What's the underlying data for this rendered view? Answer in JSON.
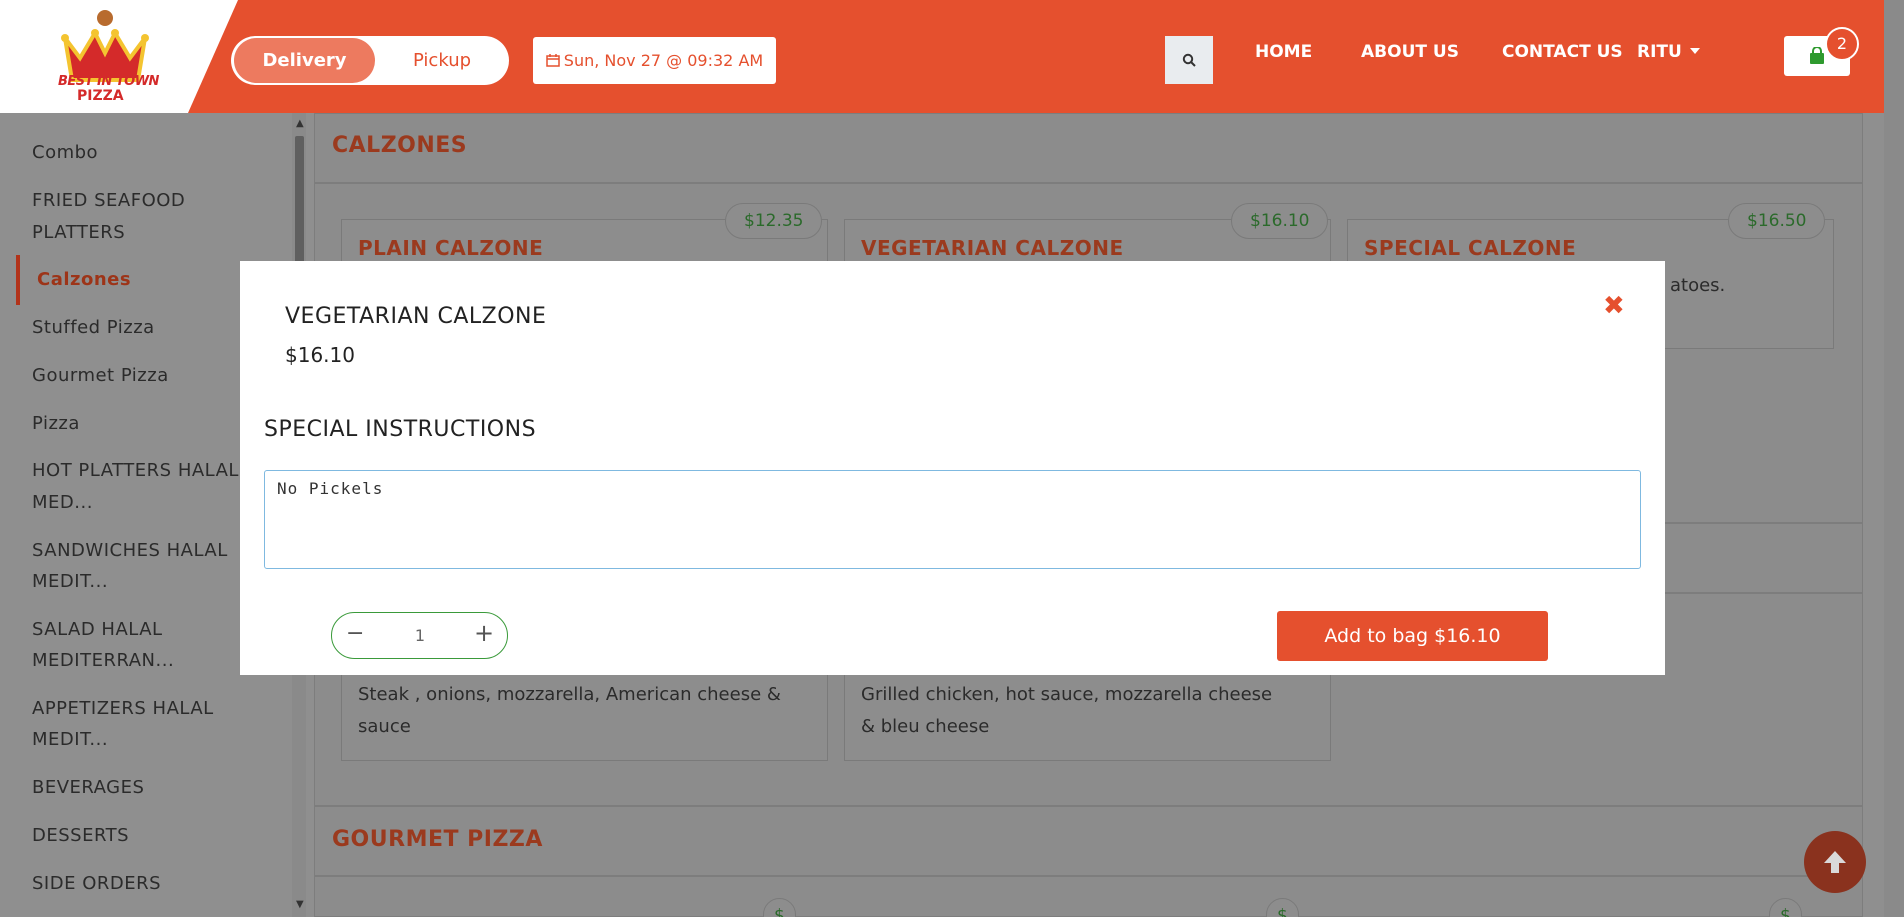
{
  "header": {
    "logo_line1": "BEST IN TOWN",
    "logo_line2": "PIZZA",
    "delivery_label": "Delivery",
    "pickup_label": "Pickup",
    "date_label": "Sun, Nov 27 @ 09:32 AM",
    "nav": {
      "home": "HOME",
      "about": "ABOUT US",
      "contact": "CONTACT US",
      "user": "RITU"
    },
    "cart_count": "2"
  },
  "sidebar": {
    "items": [
      "Combo",
      "FRIED SEAFOOD",
      "PLATTERS",
      "Calzones",
      "Stuffed Pizza",
      "Gourmet Pizza",
      "Pizza",
      "HOT PLATTERS HALAL",
      "MED...",
      "SANDWICHES HALAL",
      "MEDIT...",
      "SALAD HALAL",
      "MEDITERRAN...",
      "APPETIZERS HALAL",
      "MEDIT...",
      "BEVERAGES",
      "DESSERTS",
      "SIDE ORDERS"
    ]
  },
  "menu": {
    "calzones_title": "CALZONES",
    "cards": [
      {
        "title": "PLAIN CALZONE",
        "price": "$12.35"
      },
      {
        "title": "VEGETARIAN CALZONE",
        "price": "$16.10"
      },
      {
        "title": "SPECIAL CALZONE",
        "price": "$16.50",
        "desc_fragment": "atoes."
      }
    ],
    "card_desc_1": [
      "Steak , onions, mozzarella, American cheese &",
      "sauce"
    ],
    "card_desc_2": [
      "Grilled chicken, hot sauce, mozzarella cheese",
      "& bleu cheese"
    ],
    "gourmet_title": "GOURMET PIZZA",
    "partial_price": "$"
  },
  "modal": {
    "title": "VEGETARIAN CALZONE",
    "price": "$16.10",
    "special_instructions_label": "SPECIAL INSTRUCTIONS",
    "instructions_value": "No Pickels",
    "quantity": "1",
    "add_button": "Add to bag $16.10",
    "close_symbol": "✖"
  },
  "colors": {
    "brand": "#e5502e",
    "price_green": "#3a9a3a"
  }
}
